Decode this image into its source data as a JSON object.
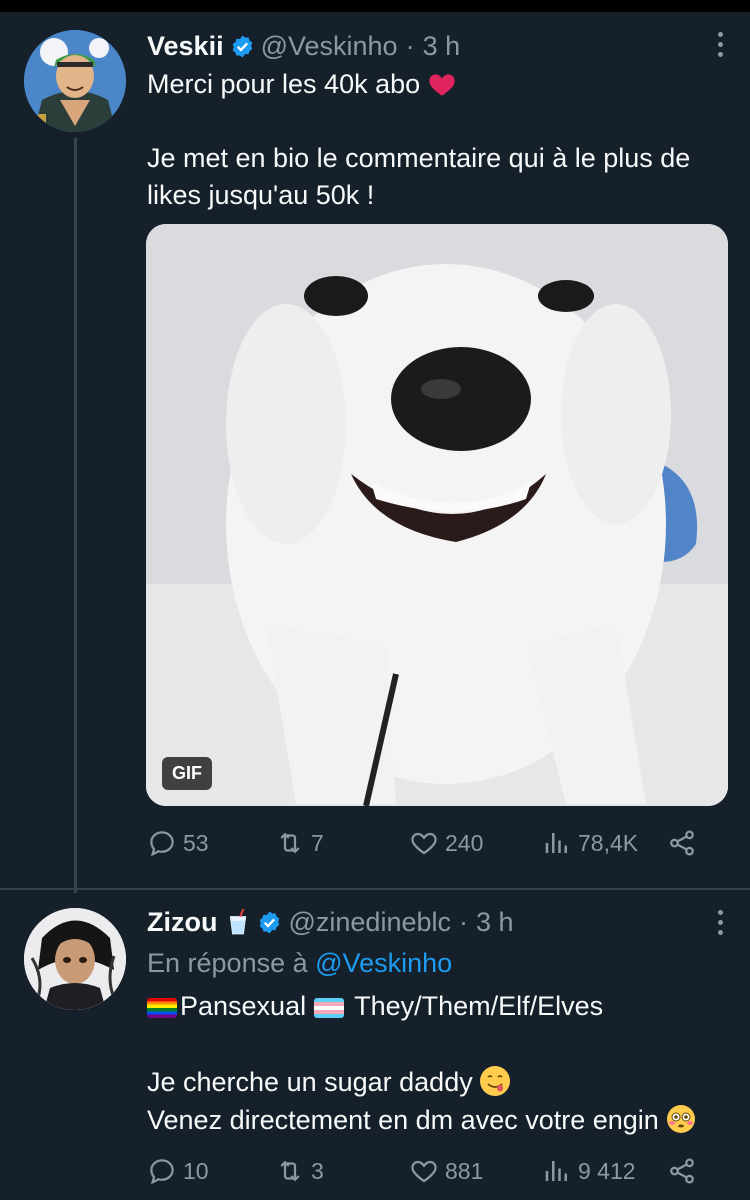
{
  "tweets": [
    {
      "name": "Veskii",
      "handle": "@Veskinho",
      "separator": "·",
      "time": "3 h",
      "text_line1": "Merci pour les 40k abo",
      "text_line1_emoji": "red-heart",
      "text_line2": "Je met en bio le commentaire qui à le plus de",
      "text_line3": "likes jusqu'au 50k !",
      "media_badge": "GIF",
      "stats": {
        "replies": "53",
        "retweets": "7",
        "likes": "240",
        "views": "78,4K"
      }
    },
    {
      "name": "Zizou",
      "name_emoji": "cup-with-straw",
      "handle": "@zinedineblc",
      "separator": "·",
      "time": "3 h",
      "reply_prefix": "En réponse à",
      "reply_mention": "@Veskinho",
      "bio_part1": "Pansexual",
      "bio_part2": "They/Them/Elf/Elves",
      "text_line1": "Je cherche un sugar daddy",
      "text_line1_emoji": "face-savoring-food",
      "text_line2": "Venez directement en dm avec votre engin",
      "text_line2_emoji": "flushed-face",
      "stats": {
        "replies": "10",
        "retweets": "3",
        "likes": "881",
        "views": "9 412"
      }
    }
  ],
  "colors": {
    "background": "#15202b",
    "text": "#f7f9f9",
    "secondary": "#8b98a5",
    "accent": "#1d9bf0",
    "heart": "#f91880"
  }
}
